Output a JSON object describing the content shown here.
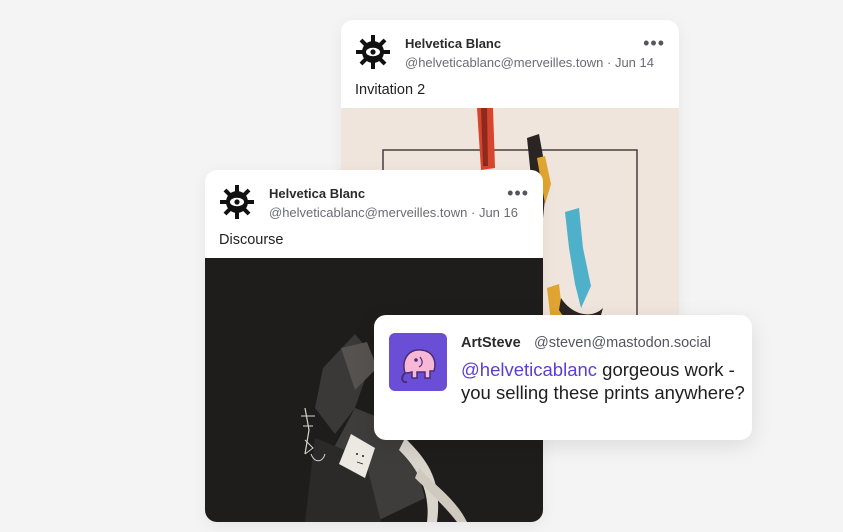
{
  "posts": [
    {
      "author": "Helvetica Blanc",
      "handle": "@helveticablanc@merveilles.town",
      "date": "Jun 14",
      "text": "Invitation 2",
      "menu": "•••"
    },
    {
      "author": "Helvetica Blanc",
      "handle": "@helveticablanc@merveilles.town",
      "date": "Jun 16",
      "text": "Discourse",
      "menu": "•••"
    }
  ],
  "reply": {
    "author": "ArtSteve",
    "handle": "@steven@mastodon.social",
    "mention": "@helveticablanc",
    "text": " gorgeous work - you selling these prints anywhere?"
  },
  "colors": {
    "mention": "#5b3fd0",
    "avatar_bg": "#6a4fd6",
    "artwork_light_bg": "#efe5dc",
    "artwork_dark_bg": "#1e1d1c"
  }
}
